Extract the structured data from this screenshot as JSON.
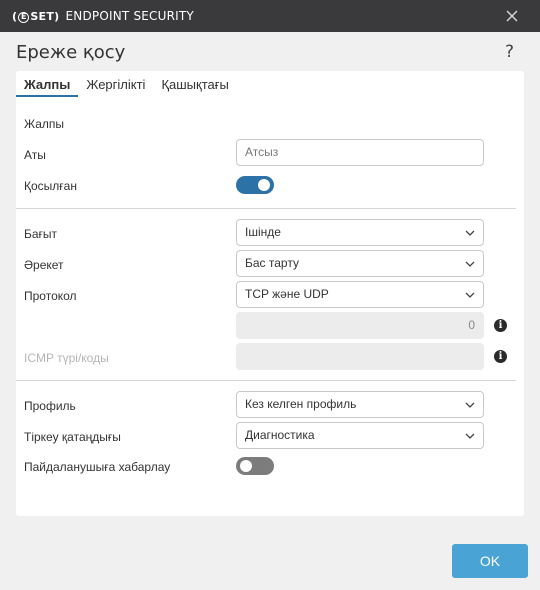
{
  "window": {
    "brand_logo": "ESET",
    "product_name": "ENDPOINT SECURITY"
  },
  "dialog": {
    "title": "Ереже қосу",
    "help": "?"
  },
  "tabs": [
    {
      "label": "Жалпы",
      "active": true
    },
    {
      "label": "Жергілікті",
      "active": false
    },
    {
      "label": "Қашықтағы",
      "active": false
    }
  ],
  "general": {
    "section_label": "Жалпы",
    "name_label": "Аты",
    "name_placeholder": "Атсыз",
    "enabled_label": "Қосылған",
    "enabled": true
  },
  "traffic": {
    "direction_label": "Бағыт",
    "direction_value": "Ішінде",
    "action_label": "Әрекет",
    "action_value": "Бас тарту",
    "protocol_label": "Протокол",
    "protocol_value": "TCP және UDP",
    "protocol_number_value": "0",
    "icmp_label": "ICMP түрі/коды",
    "icmp_value": ""
  },
  "advanced": {
    "profile_label": "Профиль",
    "profile_value": "Кез келген профиль",
    "logging_label": "Тіркеу қатаңдығы",
    "logging_value": "Диагностика",
    "notify_label": "Пайдаланушыға хабарлау",
    "notify": false
  },
  "buttons": {
    "ok": "OK"
  },
  "colors": {
    "titlebar": "#3a3a3c",
    "accent": "#2c72a7",
    "ok_button": "#4aa3d5",
    "toggle_off": "#7c7c7c"
  },
  "icons": {
    "close": "close-icon",
    "help": "help-icon",
    "chevron": "chevron-down-icon",
    "info": "info-icon"
  }
}
